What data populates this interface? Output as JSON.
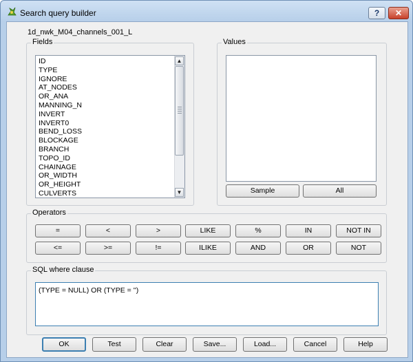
{
  "window": {
    "title": "Search query builder",
    "help_glyph": "?",
    "close_glyph": "✕"
  },
  "layer_name": "1d_nwk_M04_channels_001_L",
  "fields": {
    "label": "Fields",
    "items": [
      "ID",
      "TYPE",
      "IGNORE",
      "AT_NODES",
      "OR_ANA",
      "MANNING_N",
      "INVERT",
      "INVERT0",
      "BEND_LOSS",
      "BLOCKAGE",
      "BRANCH",
      "TOPO_ID",
      "CHAINAGE",
      "OR_WIDTH",
      "OR_HEIGHT",
      "CULVERTS"
    ],
    "scroll_up": "▲",
    "scroll_down": "▼"
  },
  "values": {
    "label": "Values",
    "sample_label": "Sample",
    "all_label": "All"
  },
  "operators": {
    "label": "Operators",
    "row1": [
      "=",
      "<",
      ">",
      "LIKE",
      "%",
      "IN",
      "NOT IN"
    ],
    "row2": [
      "<=",
      ">=",
      "!=",
      "ILIKE",
      "AND",
      "OR",
      "NOT"
    ]
  },
  "sql": {
    "label": "SQL where clause",
    "value": "(TYPE = NULL)  OR (TYPE  = '')"
  },
  "buttons": {
    "ok": "OK",
    "test": "Test",
    "clear": "Clear",
    "save": "Save...",
    "load": "Load...",
    "cancel": "Cancel",
    "help": "Help"
  }
}
